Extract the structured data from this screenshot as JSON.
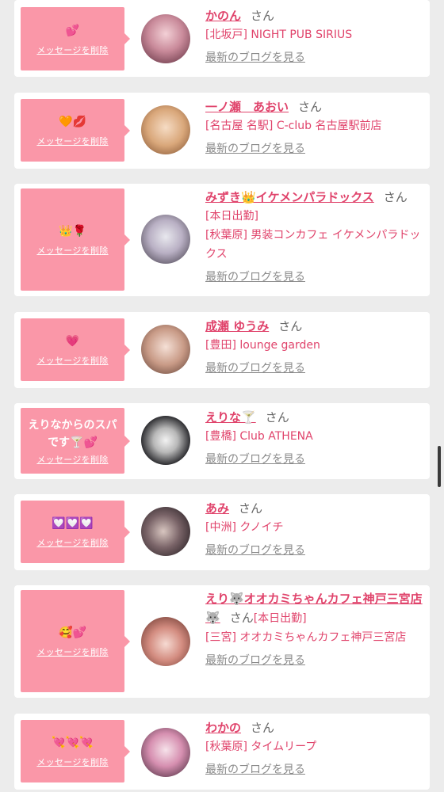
{
  "common": {
    "delete_label": "メッセージを削除",
    "san": "さん",
    "blog_label": "最新のブログを見る"
  },
  "items": [
    {
      "message": "💕",
      "name": "かのん",
      "shop": "[北坂戸] NIGHT PUB SIRIUS"
    },
    {
      "message": "🧡💋",
      "name": "一ノ瀬　あおい",
      "shop": "[名古屋 名駅] C-club 名古屋駅前店"
    },
    {
      "message": "👑🌹",
      "name": "みずき👑イケメンパラドックス",
      "status": "[本日出勤]",
      "shop": "[秋葉原] 男装コンカフェ イケメンパラドックス"
    },
    {
      "message": "💗",
      "name": "成瀬 ゆうみ",
      "shop": "[豊田] lounge garden"
    },
    {
      "message": "えりなからのスパです🍸💕",
      "name": "えりな🍸",
      "shop": "[豊橋] Club ATHENA"
    },
    {
      "message": "💟💟💟",
      "name": "あみ",
      "shop": "[中洲] クノイチ"
    },
    {
      "message": "🥰💕",
      "name": "えり🐺オオカミちゃんカフェ神戸三宮店🐺",
      "status": "[本日出勤]",
      "shop": "[三宮] オオカミちゃんカフェ神戸三宮店"
    },
    {
      "message": "💘💘💘",
      "name": "わかの",
      "shop": "[秋葉原] タイムリープ"
    }
  ]
}
